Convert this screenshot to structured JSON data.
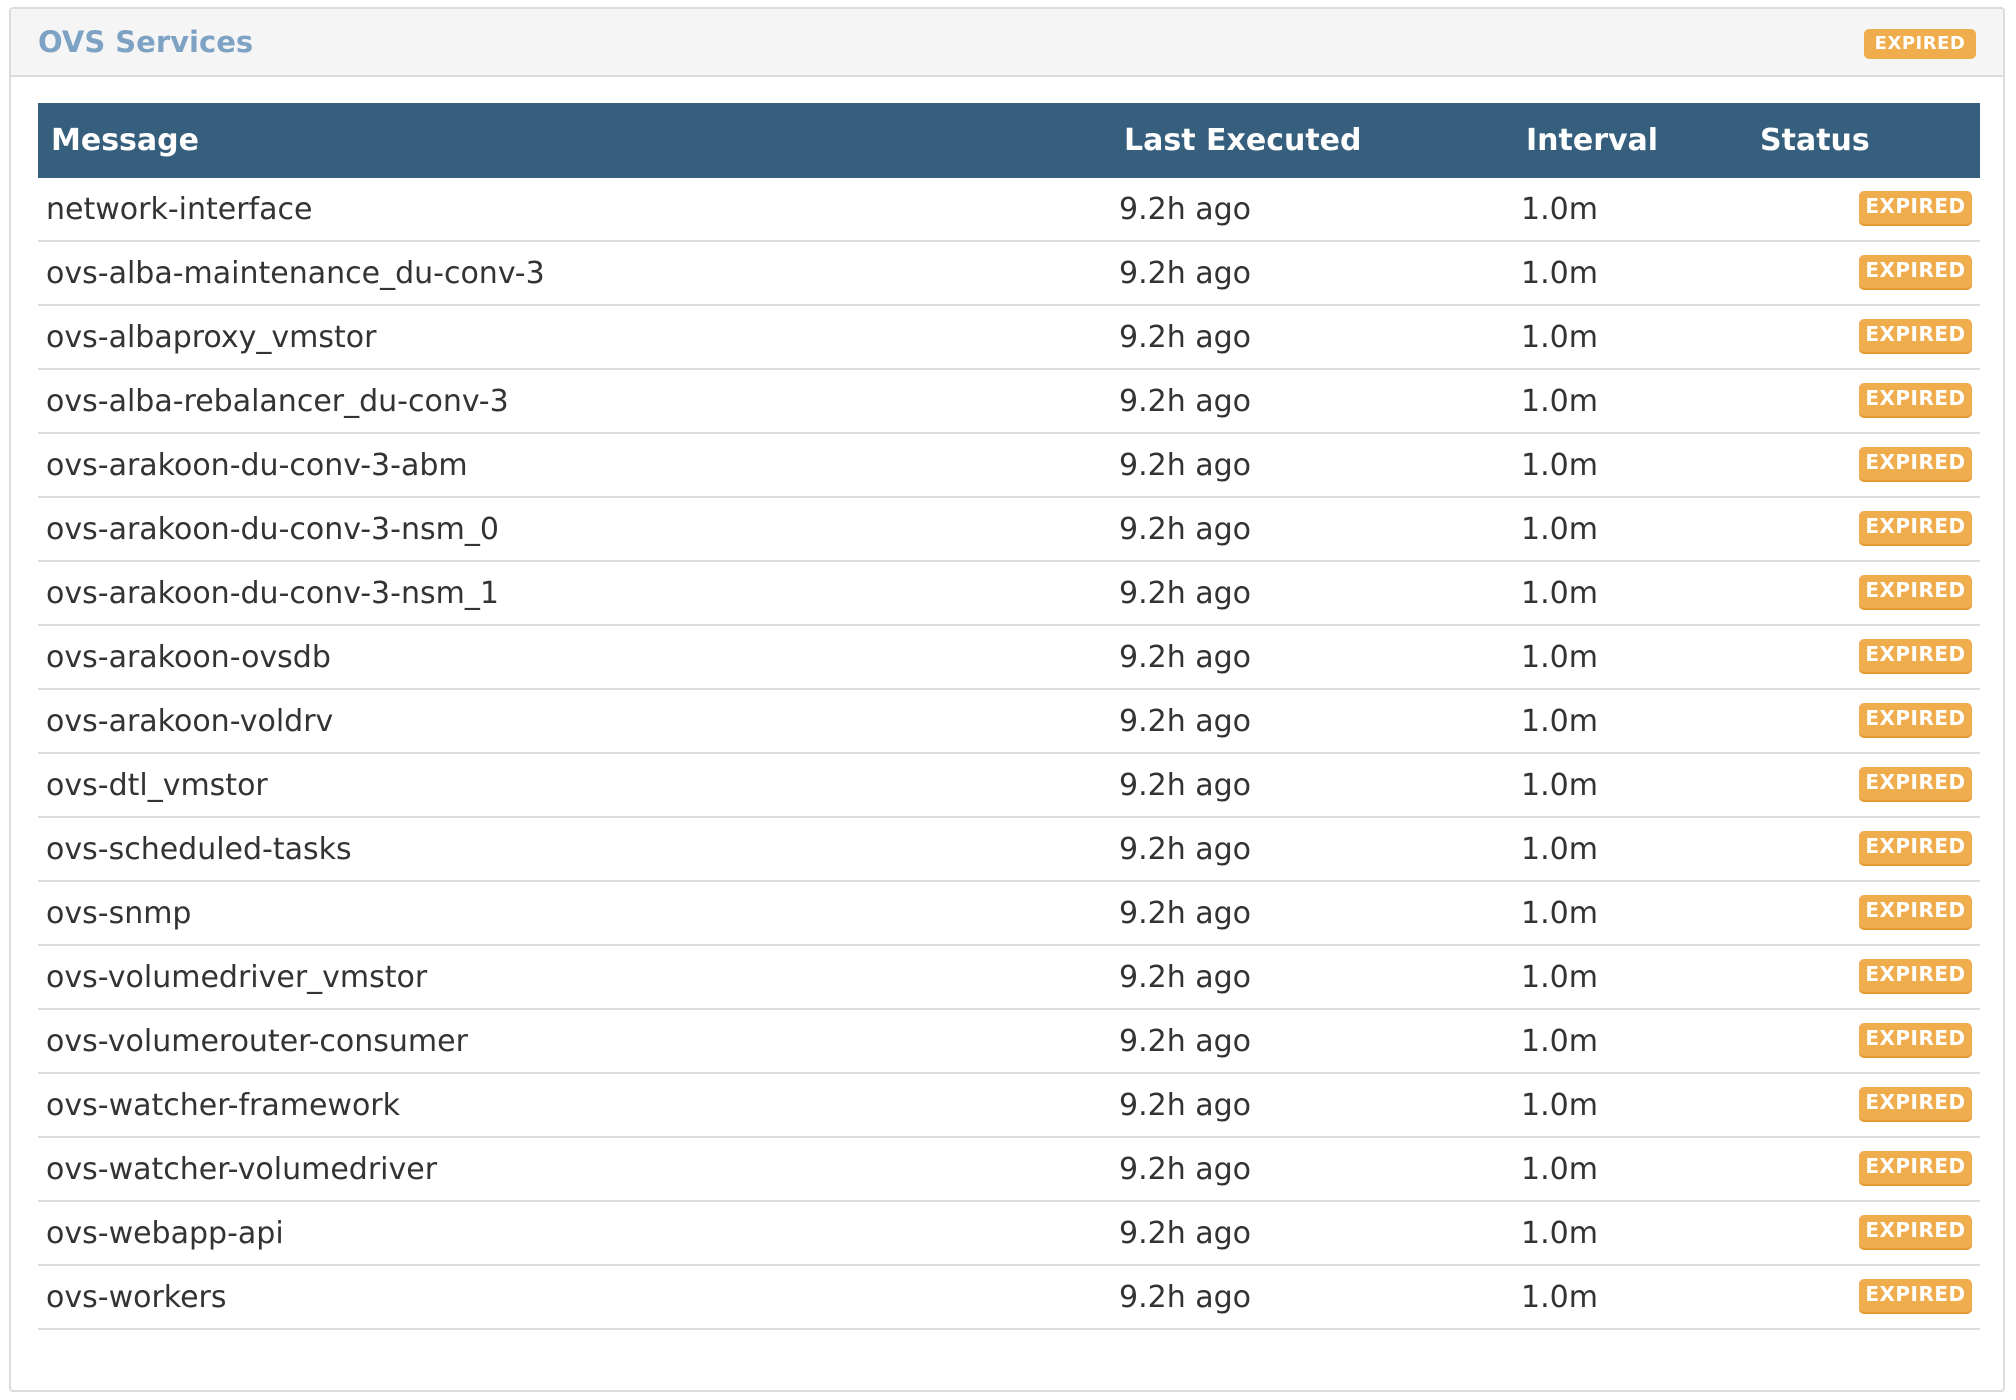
{
  "panel": {
    "title": "OVS Services",
    "status_badge": "EXPIRED",
    "colors": {
      "title": "#7ea2c4",
      "table_header_bg": "#365f7e",
      "badge_bg": "#f0ad4e"
    }
  },
  "table": {
    "columns": [
      "Message",
      "Last Executed",
      "Interval",
      "Status"
    ],
    "rows": [
      {
        "message": "network-interface",
        "last_executed": "9.2h ago",
        "interval": "1.0m",
        "status": "EXPIRED"
      },
      {
        "message": "ovs-alba-maintenance_du-conv-3",
        "last_executed": "9.2h ago",
        "interval": "1.0m",
        "status": "EXPIRED"
      },
      {
        "message": "ovs-albaproxy_vmstor",
        "last_executed": "9.2h ago",
        "interval": "1.0m",
        "status": "EXPIRED"
      },
      {
        "message": "ovs-alba-rebalancer_du-conv-3",
        "last_executed": "9.2h ago",
        "interval": "1.0m",
        "status": "EXPIRED"
      },
      {
        "message": "ovs-arakoon-du-conv-3-abm",
        "last_executed": "9.2h ago",
        "interval": "1.0m",
        "status": "EXPIRED"
      },
      {
        "message": "ovs-arakoon-du-conv-3-nsm_0",
        "last_executed": "9.2h ago",
        "interval": "1.0m",
        "status": "EXPIRED"
      },
      {
        "message": "ovs-arakoon-du-conv-3-nsm_1",
        "last_executed": "9.2h ago",
        "interval": "1.0m",
        "status": "EXPIRED"
      },
      {
        "message": "ovs-arakoon-ovsdb",
        "last_executed": "9.2h ago",
        "interval": "1.0m",
        "status": "EXPIRED"
      },
      {
        "message": "ovs-arakoon-voldrv",
        "last_executed": "9.2h ago",
        "interval": "1.0m",
        "status": "EXPIRED"
      },
      {
        "message": "ovs-dtl_vmstor",
        "last_executed": "9.2h ago",
        "interval": "1.0m",
        "status": "EXPIRED"
      },
      {
        "message": "ovs-scheduled-tasks",
        "last_executed": "9.2h ago",
        "interval": "1.0m",
        "status": "EXPIRED"
      },
      {
        "message": "ovs-snmp",
        "last_executed": "9.2h ago",
        "interval": "1.0m",
        "status": "EXPIRED"
      },
      {
        "message": "ovs-volumedriver_vmstor",
        "last_executed": "9.2h ago",
        "interval": "1.0m",
        "status": "EXPIRED"
      },
      {
        "message": "ovs-volumerouter-consumer",
        "last_executed": "9.2h ago",
        "interval": "1.0m",
        "status": "EXPIRED"
      },
      {
        "message": "ovs-watcher-framework",
        "last_executed": "9.2h ago",
        "interval": "1.0m",
        "status": "EXPIRED"
      },
      {
        "message": "ovs-watcher-volumedriver",
        "last_executed": "9.2h ago",
        "interval": "1.0m",
        "status": "EXPIRED"
      },
      {
        "message": "ovs-webapp-api",
        "last_executed": "9.2h ago",
        "interval": "1.0m",
        "status": "EXPIRED"
      },
      {
        "message": "ovs-workers",
        "last_executed": "9.2h ago",
        "interval": "1.0m",
        "status": "EXPIRED"
      }
    ]
  }
}
